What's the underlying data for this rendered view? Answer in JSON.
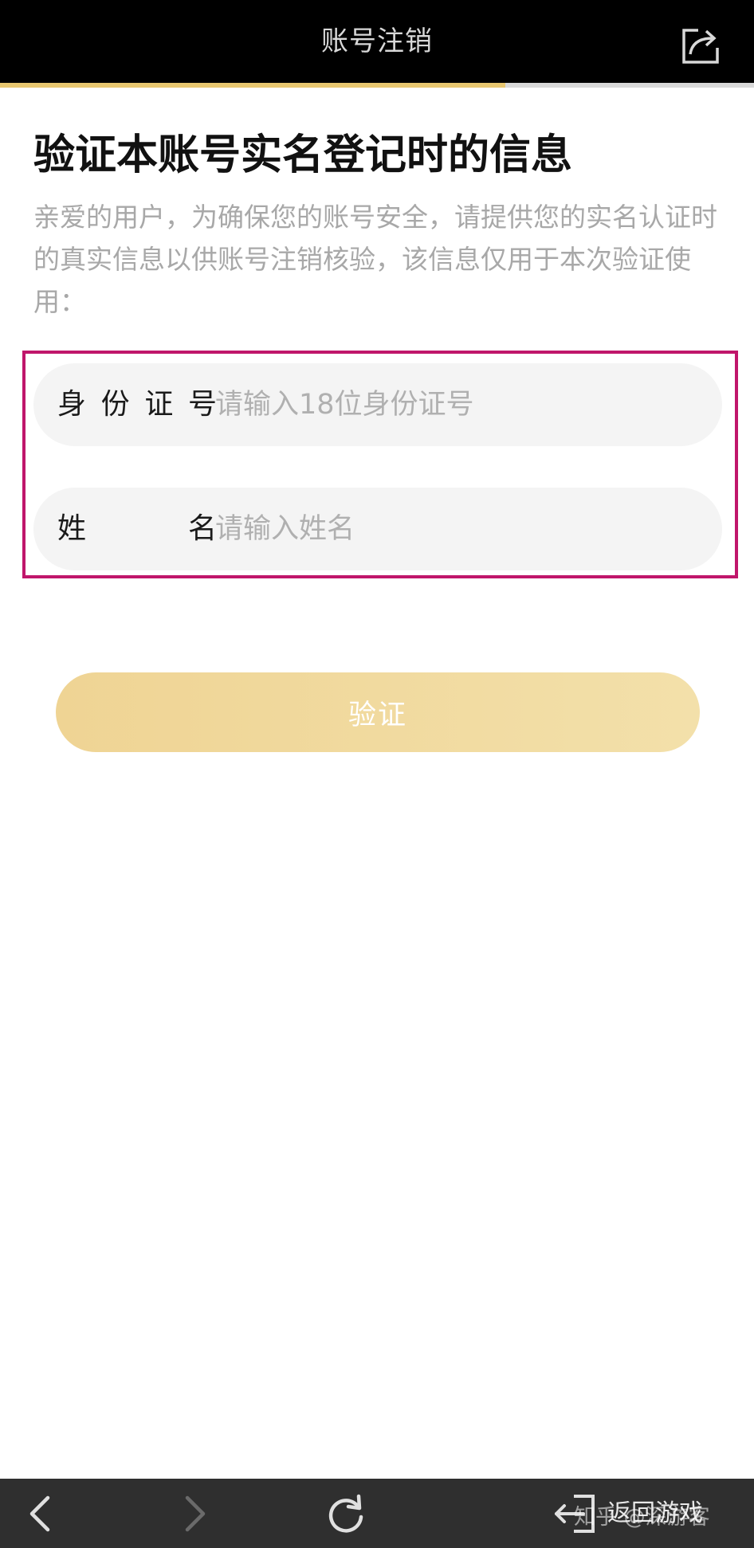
{
  "header": {
    "title": "账号注销",
    "progress_percent": 67
  },
  "main": {
    "heading": "验证本账号实名登记时的信息",
    "description": "亲爱的用户，为确保您的账号安全，请提供您的实名认证时的真实信息以供账号注销核验，该信息仅用于本次验证使用："
  },
  "form": {
    "id_field": {
      "label": "身份证号",
      "placeholder": "请输入18位身份证号",
      "value": ""
    },
    "name_field": {
      "label": "姓名",
      "placeholder": "请输入姓名",
      "value": ""
    },
    "verify_label": "验证"
  },
  "bottom_bar": {
    "exit_label": "返回游戏",
    "watermark": "知乎 @深游客"
  },
  "icons": {
    "share": "share-icon",
    "back": "chevron-left-icon",
    "forward": "chevron-right-icon",
    "refresh": "refresh-icon",
    "exit": "exit-icon"
  },
  "colors": {
    "accent": "#e8c770",
    "highlight_border": "#c0166b",
    "button_start": "#efd494",
    "button_end": "#f3e0aa"
  }
}
